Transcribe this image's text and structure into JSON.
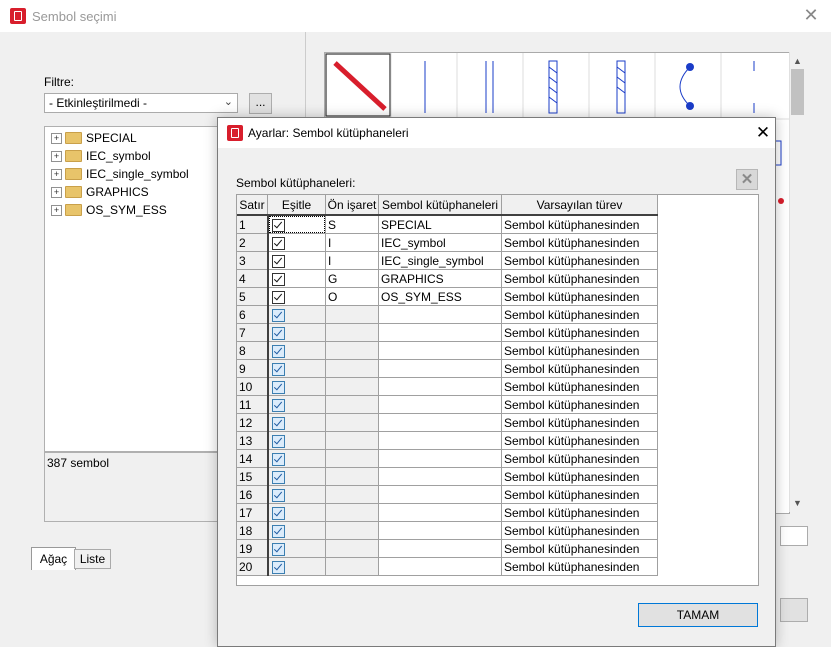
{
  "back_window": {
    "title": "Sembol seçimi",
    "filter_label": "Filtre:",
    "filter_value": "- Etkinleştirilmedi -",
    "filter_more_label": "...",
    "tree_items": [
      "SPECIAL",
      "IEC_symbol",
      "IEC_single_symbol",
      "GRAPHICS",
      "OS_SYM_ESS"
    ],
    "status_text": "387 sembol",
    "tabs": [
      "Ağaç",
      "Liste"
    ]
  },
  "dialog": {
    "title": "Ayarlar: Sembol kütüphaneleri",
    "section_label": "Sembol kütüphaneleri:",
    "columns": [
      "Satır",
      "Eşitle",
      "Ön işaret",
      "Sembol kütüphaneleri",
      "Varsayılan türev"
    ],
    "rows": [
      {
        "num": "1",
        "sync": true,
        "prefix": "S",
        "library": "SPECIAL",
        "variant": "Sembol kütüphanesinden",
        "style": "dark"
      },
      {
        "num": "2",
        "sync": true,
        "prefix": "I",
        "library": "IEC_symbol",
        "variant": "Sembol kütüphanesinden",
        "style": "dark"
      },
      {
        "num": "3",
        "sync": true,
        "prefix": "I",
        "library": "IEC_single_symbol",
        "variant": "Sembol kütüphanesinden",
        "style": "dark"
      },
      {
        "num": "4",
        "sync": true,
        "prefix": "G",
        "library": "GRAPHICS",
        "variant": "Sembol kütüphanesinden",
        "style": "dark"
      },
      {
        "num": "5",
        "sync": true,
        "prefix": "O",
        "library": "OS_SYM_ESS",
        "variant": "Sembol kütüphanesinden",
        "style": "dark"
      },
      {
        "num": "6",
        "sync": true,
        "prefix": "",
        "library": "",
        "variant": "Sembol kütüphanesinden",
        "style": "blue"
      },
      {
        "num": "7",
        "sync": true,
        "prefix": "",
        "library": "",
        "variant": "Sembol kütüphanesinden",
        "style": "blue"
      },
      {
        "num": "8",
        "sync": true,
        "prefix": "",
        "library": "",
        "variant": "Sembol kütüphanesinden",
        "style": "blue"
      },
      {
        "num": "9",
        "sync": true,
        "prefix": "",
        "library": "",
        "variant": "Sembol kütüphanesinden",
        "style": "blue"
      },
      {
        "num": "10",
        "sync": true,
        "prefix": "",
        "library": "",
        "variant": "Sembol kütüphanesinden",
        "style": "blue"
      },
      {
        "num": "11",
        "sync": true,
        "prefix": "",
        "library": "",
        "variant": "Sembol kütüphanesinden",
        "style": "blue"
      },
      {
        "num": "12",
        "sync": true,
        "prefix": "",
        "library": "",
        "variant": "Sembol kütüphanesinden",
        "style": "blue"
      },
      {
        "num": "13",
        "sync": true,
        "prefix": "",
        "library": "",
        "variant": "Sembol kütüphanesinden",
        "style": "blue"
      },
      {
        "num": "14",
        "sync": true,
        "prefix": "",
        "library": "",
        "variant": "Sembol kütüphanesinden",
        "style": "blue"
      },
      {
        "num": "15",
        "sync": true,
        "prefix": "",
        "library": "",
        "variant": "Sembol kütüphanesinden",
        "style": "blue"
      },
      {
        "num": "16",
        "sync": true,
        "prefix": "",
        "library": "",
        "variant": "Sembol kütüphanesinden",
        "style": "blue"
      },
      {
        "num": "17",
        "sync": true,
        "prefix": "",
        "library": "",
        "variant": "Sembol kütüphanesinden",
        "style": "blue"
      },
      {
        "num": "18",
        "sync": true,
        "prefix": "",
        "library": "",
        "variant": "Sembol kütüphanesinden",
        "style": "blue"
      },
      {
        "num": "19",
        "sync": true,
        "prefix": "",
        "library": "",
        "variant": "Sembol kütüphanesinden",
        "style": "blue"
      },
      {
        "num": "20",
        "sync": true,
        "prefix": "",
        "library": "",
        "variant": "Sembol kütüphanesinden",
        "style": "blue"
      }
    ],
    "ok_label": "TAMAM"
  },
  "colors": {
    "app_icon": "#d81e2c",
    "accent_blue": "#0078d7"
  }
}
